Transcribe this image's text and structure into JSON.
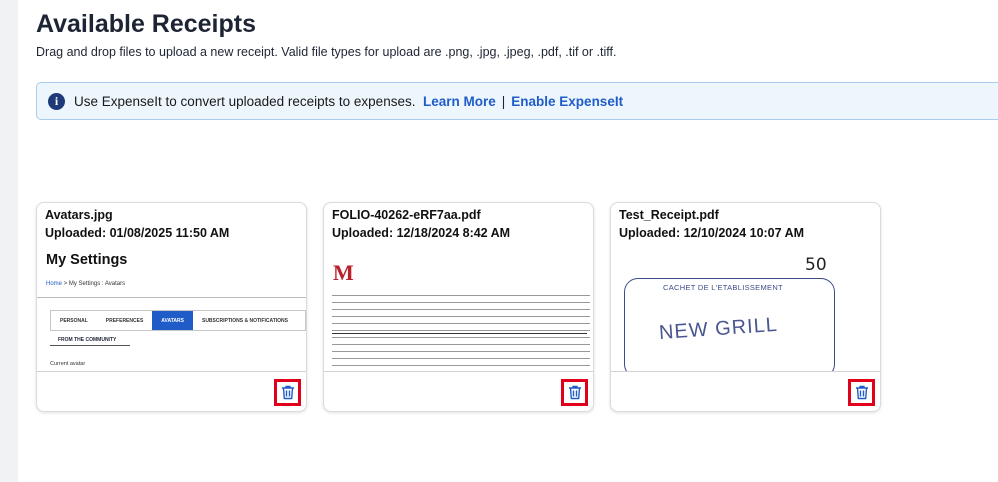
{
  "page": {
    "title": "Available Receipts",
    "subtitle": "Drag and drop files to upload a new receipt. Valid file types for upload are .png, .jpg, .jpeg, .pdf, .tif or .tiff."
  },
  "banner": {
    "icon": "info-icon",
    "text": "Use ExpenseIt to convert uploaded receipts to expenses.",
    "learn_more": "Learn More",
    "separator": "|",
    "enable": "Enable ExpenseIt"
  },
  "receipts": [
    {
      "name": "Avatars.jpg",
      "uploaded": "Uploaded: 01/08/2025 11:50 AM",
      "preview": {
        "heading": "My Settings",
        "crumb_home": "Home",
        "crumb_rest": " > My Settings : Avatars",
        "tabs": [
          "PERSONAL",
          "PREFERENCES",
          "AVATARS",
          "SUBSCRIPTIONS & NOTIFICATIONS"
        ],
        "section": "FROM THE COMMUNITY",
        "current": "Current avatar"
      },
      "delete_icon": "trash-icon"
    },
    {
      "name": "FOLIO-40262-eRF7aa.pdf",
      "uploaded": "Uploaded: 12/18/2024 8:42 AM",
      "delete_icon": "trash-icon"
    },
    {
      "name": "Test_Receipt.pdf",
      "uploaded": "Uploaded: 12/10/2024 10:07 AM",
      "preview": {
        "number": "50",
        "stamp_label": "CACHET DE L'ETABLISSEMENT",
        "stamp_name": "NEW GRILL"
      },
      "delete_icon": "trash-icon"
    }
  ],
  "colors": {
    "accent": "#1f5cc8",
    "banner_bg": "#eef6fd",
    "highlight": "#e0001a"
  }
}
